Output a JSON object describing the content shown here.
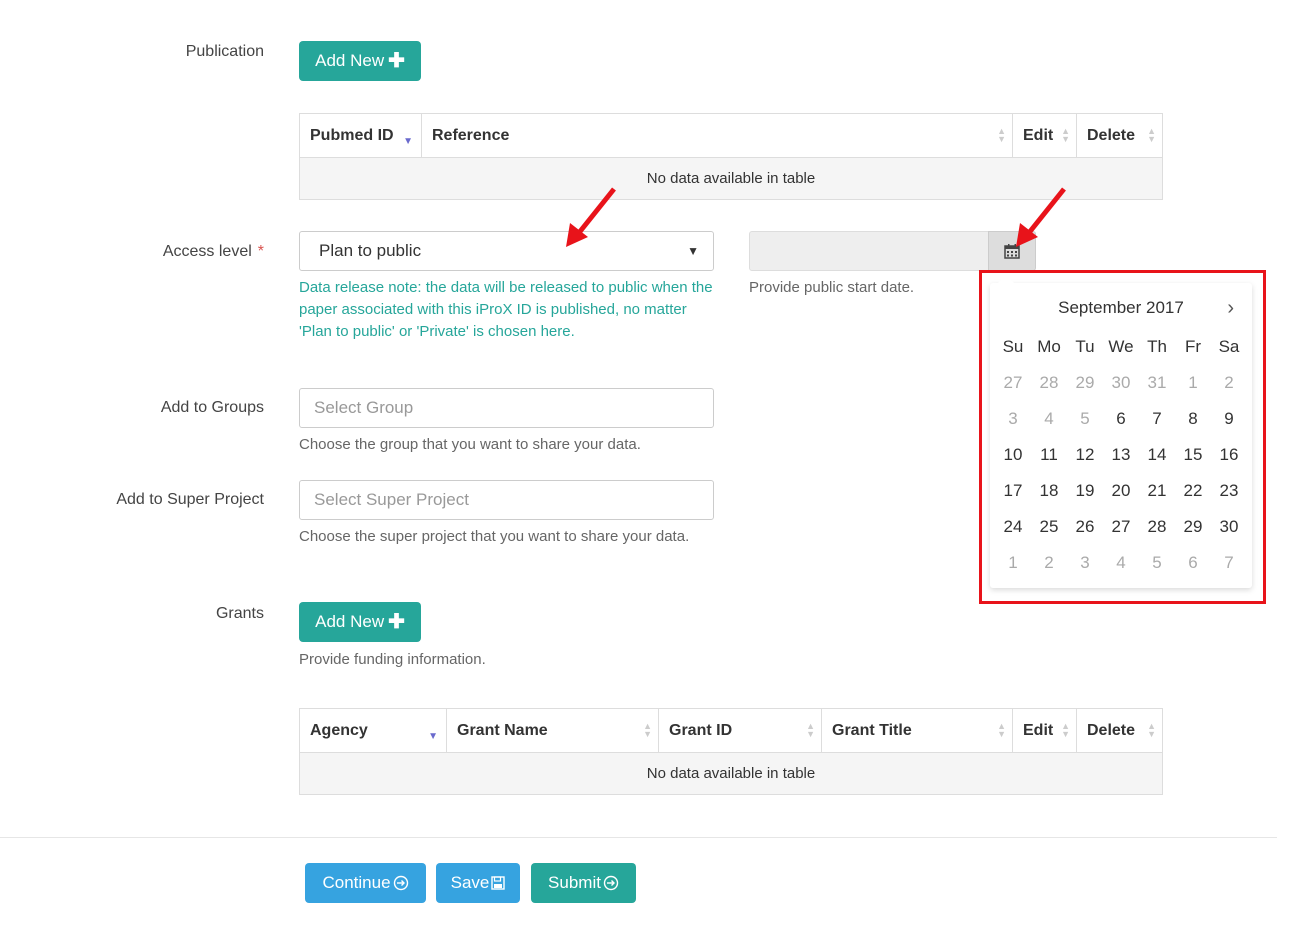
{
  "publication": {
    "label": "Publication",
    "add_button": "Add New",
    "table": {
      "headers": [
        "Pubmed ID",
        "Reference",
        "Edit",
        "Delete"
      ],
      "empty_text": "No data available in table"
    }
  },
  "access_level": {
    "label": "Access level",
    "required_mark": "*",
    "value": "Plan to public",
    "note": "Data release note: the data will be released to public when the paper associated with this iProX ID is published, no matter 'Plan to public' or 'Private' is chosen here."
  },
  "public_date": {
    "help": "Provide public start date.",
    "value": "",
    "icon": "calendar-icon"
  },
  "calendar": {
    "month_title": "September 2017",
    "next": "›",
    "days_of_week": [
      "Su",
      "Mo",
      "Tu",
      "We",
      "Th",
      "Fr",
      "Sa"
    ],
    "weeks": [
      [
        {
          "d": "27",
          "dim": true
        },
        {
          "d": "28",
          "dim": true
        },
        {
          "d": "29",
          "dim": true
        },
        {
          "d": "30",
          "dim": true
        },
        {
          "d": "31",
          "dim": true
        },
        {
          "d": "1",
          "dim": true
        },
        {
          "d": "2",
          "dim": true
        }
      ],
      [
        {
          "d": "3",
          "dim": true
        },
        {
          "d": "4",
          "dim": true
        },
        {
          "d": "5",
          "dim": true
        },
        {
          "d": "6",
          "dim": false
        },
        {
          "d": "7",
          "dim": false
        },
        {
          "d": "8",
          "dim": false
        },
        {
          "d": "9",
          "dim": false
        }
      ],
      [
        {
          "d": "10",
          "dim": false
        },
        {
          "d": "11",
          "dim": false
        },
        {
          "d": "12",
          "dim": false
        },
        {
          "d": "13",
          "dim": false
        },
        {
          "d": "14",
          "dim": false
        },
        {
          "d": "15",
          "dim": false
        },
        {
          "d": "16",
          "dim": false
        }
      ],
      [
        {
          "d": "17",
          "dim": false
        },
        {
          "d": "18",
          "dim": false
        },
        {
          "d": "19",
          "dim": false
        },
        {
          "d": "20",
          "dim": false
        },
        {
          "d": "21",
          "dim": false
        },
        {
          "d": "22",
          "dim": false
        },
        {
          "d": "23",
          "dim": false
        }
      ],
      [
        {
          "d": "24",
          "dim": false
        },
        {
          "d": "25",
          "dim": false
        },
        {
          "d": "26",
          "dim": false
        },
        {
          "d": "27",
          "dim": false
        },
        {
          "d": "28",
          "dim": false
        },
        {
          "d": "29",
          "dim": false
        },
        {
          "d": "30",
          "dim": false
        }
      ],
      [
        {
          "d": "1",
          "dim": true
        },
        {
          "d": "2",
          "dim": true
        },
        {
          "d": "3",
          "dim": true
        },
        {
          "d": "4",
          "dim": true
        },
        {
          "d": "5",
          "dim": true
        },
        {
          "d": "6",
          "dim": true
        },
        {
          "d": "7",
          "dim": true
        }
      ]
    ]
  },
  "groups": {
    "label": "Add to Groups",
    "placeholder": "Select Group",
    "help": "Choose the group that you want to share your data."
  },
  "super_project": {
    "label": "Add to Super Project",
    "placeholder": "Select Super Project",
    "help": "Choose the super project that you want to share your data."
  },
  "grants": {
    "label": "Grants",
    "add_button": "Add New",
    "help": "Provide funding information.",
    "table": {
      "headers": [
        "Agency",
        "Grant Name",
        "Grant ID",
        "Grant Title",
        "Edit",
        "Delete"
      ],
      "empty_text": "No data available in table"
    }
  },
  "footer": {
    "continue": "Continue",
    "save": "Save",
    "submit": "Submit"
  },
  "colors": {
    "teal": "#26a69a",
    "blue": "#36a3e0",
    "annotation_red": "#e8131a"
  }
}
